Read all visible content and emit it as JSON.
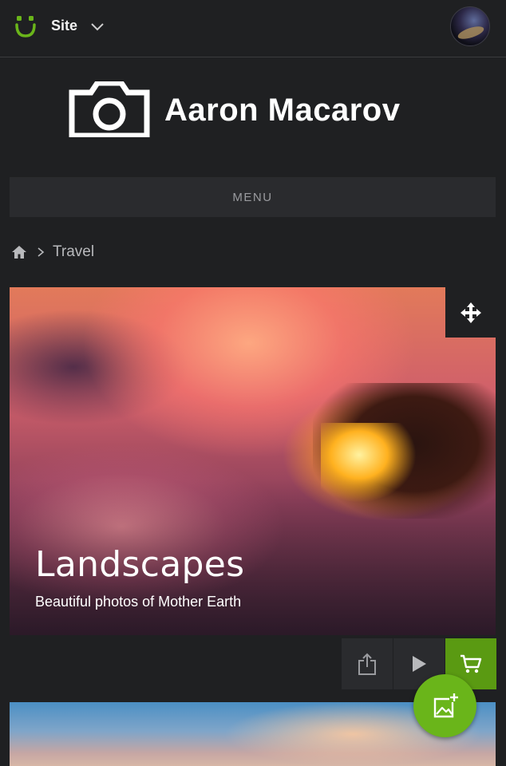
{
  "topbar": {
    "site_label": "Site"
  },
  "brand": {
    "name": "Aaron Macarov"
  },
  "menu": {
    "label": "MENU"
  },
  "breadcrumb": {
    "current": "Travel"
  },
  "gallery": {
    "title": "Landscapes",
    "subtitle": "Beautiful photos of Mother Earth"
  },
  "colors": {
    "background": "#1f2022",
    "accent_green": "#6ab51a",
    "cart_green": "#5a9a12",
    "panel": "#2a2b2e"
  },
  "icons": {
    "logo": "smile-logo-icon",
    "site_dropdown": "chevron-down-icon",
    "brand": "camera-icon",
    "home": "home-icon",
    "breadcrumb_separator": "chevron-right-icon",
    "move": "move-arrows-icon",
    "share": "share-icon",
    "play": "play-icon",
    "cart": "cart-icon",
    "add_photo": "add-photo-icon"
  }
}
